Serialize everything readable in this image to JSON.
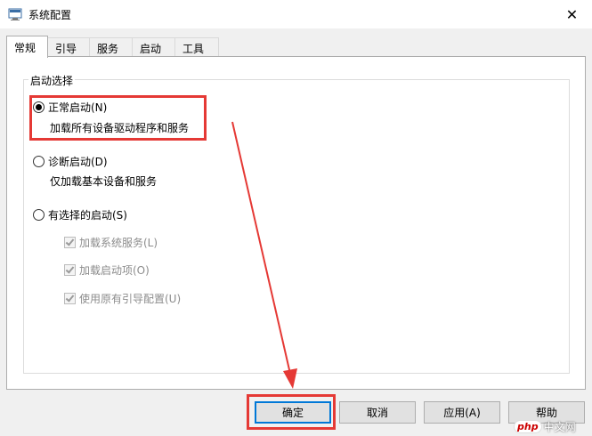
{
  "window": {
    "title": "系统配置",
    "close_glyph": "✕"
  },
  "tabs": [
    {
      "label": "常规",
      "active": true
    },
    {
      "label": "引导",
      "active": false
    },
    {
      "label": "服务",
      "active": false
    },
    {
      "label": "启动",
      "active": false
    },
    {
      "label": "工具",
      "active": false
    }
  ],
  "startup_selection": {
    "legend": "启动选择",
    "options": [
      {
        "label": "正常启动(N)",
        "description": "加载所有设备驱动程序和服务",
        "checked": true
      },
      {
        "label": "诊断启动(D)",
        "description": "仅加载基本设备和服务",
        "checked": false
      },
      {
        "label": "有选择的启动(S)",
        "checked": false
      }
    ],
    "selective_items": [
      {
        "label": "加载系统服务(L)",
        "checked": true,
        "enabled": false
      },
      {
        "label": "加载启动项(O)",
        "checked": true,
        "enabled": false
      },
      {
        "label": "使用原有引导配置(U)",
        "checked": true,
        "enabled": false
      }
    ]
  },
  "buttons": {
    "ok": "确定",
    "cancel": "取消",
    "apply": "应用(A)",
    "help": "帮助"
  },
  "watermark": {
    "logo": "php",
    "text": "中文网"
  },
  "colors": {
    "annotation": "#e53935",
    "default_button_border": "#0078d7"
  },
  "icons": {
    "app": "msconfig-icon",
    "close": "close-icon"
  }
}
